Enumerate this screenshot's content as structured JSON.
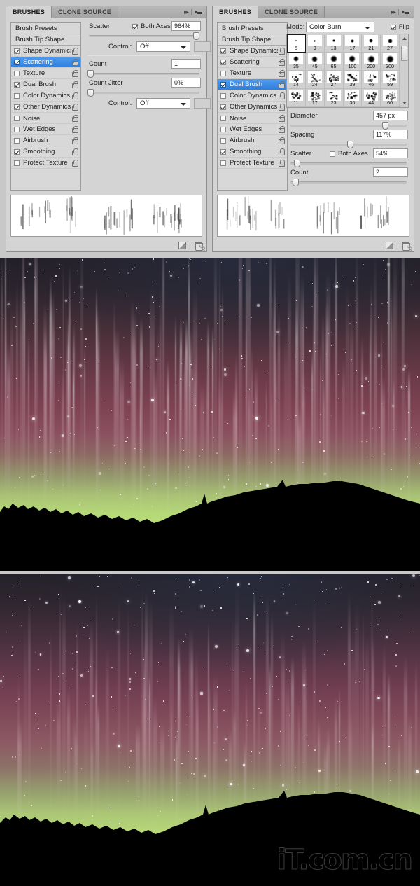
{
  "panels": {
    "left": {
      "tabs": [
        {
          "label": "BRUSHES",
          "active": true
        },
        {
          "label": "CLONE SOURCE",
          "active": false
        }
      ],
      "options": [
        {
          "label": "Brush Presets",
          "type": "header",
          "checkbox": null,
          "selected": false,
          "lock": false
        },
        {
          "label": "Brush Tip Shape",
          "type": "header",
          "checkbox": null,
          "selected": false,
          "lock": false
        },
        {
          "label": "Shape Dynamics",
          "type": "item",
          "checkbox": true,
          "selected": false,
          "lock": true
        },
        {
          "label": "Scattering",
          "type": "item",
          "checkbox": true,
          "selected": true,
          "lock": true
        },
        {
          "label": "Texture",
          "type": "item",
          "checkbox": false,
          "selected": false,
          "lock": true
        },
        {
          "label": "Dual Brush",
          "type": "item",
          "checkbox": true,
          "selected": false,
          "lock": true
        },
        {
          "label": "Color Dynamics",
          "type": "item",
          "checkbox": false,
          "selected": false,
          "lock": true
        },
        {
          "label": "Other Dynamics",
          "type": "item",
          "checkbox": true,
          "selected": false,
          "lock": true
        },
        {
          "label": "Noise",
          "type": "item-sep",
          "checkbox": false,
          "selected": false,
          "lock": true
        },
        {
          "label": "Wet Edges",
          "type": "item",
          "checkbox": false,
          "selected": false,
          "lock": true
        },
        {
          "label": "Airbrush",
          "type": "item",
          "checkbox": false,
          "selected": false,
          "lock": true
        },
        {
          "label": "Smoothing",
          "type": "item",
          "checkbox": true,
          "selected": false,
          "lock": true
        },
        {
          "label": "Protect Texture",
          "type": "item",
          "checkbox": false,
          "selected": false,
          "lock": true
        }
      ],
      "controls": {
        "scatter_label": "Scatter",
        "scatter_value": "964%",
        "both_axes_label": "Both Axes",
        "both_axes_checked": true,
        "control1_label": "Control:",
        "control1_value": "Off",
        "count_label": "Count",
        "count_value": "1",
        "count_jitter_label": "Count Jitter",
        "count_jitter_value": "0%",
        "control2_label": "Control:",
        "control2_value": "Off"
      }
    },
    "right": {
      "tabs": [
        {
          "label": "BRUSHES",
          "active": true
        },
        {
          "label": "CLONE SOURCE",
          "active": false
        }
      ],
      "options": [
        {
          "label": "Brush Presets",
          "type": "header",
          "checkbox": null,
          "selected": false,
          "lock": false
        },
        {
          "label": "Brush Tip Shape",
          "type": "header",
          "checkbox": null,
          "selected": false,
          "lock": false
        },
        {
          "label": "Shape Dynamics",
          "type": "item",
          "checkbox": true,
          "selected": false,
          "lock": true
        },
        {
          "label": "Scattering",
          "type": "item",
          "checkbox": true,
          "selected": false,
          "lock": true
        },
        {
          "label": "Texture",
          "type": "item",
          "checkbox": false,
          "selected": false,
          "lock": true
        },
        {
          "label": "Dual Brush",
          "type": "item",
          "checkbox": true,
          "selected": true,
          "lock": true
        },
        {
          "label": "Color Dynamics",
          "type": "item",
          "checkbox": false,
          "selected": false,
          "lock": true
        },
        {
          "label": "Other Dynamics",
          "type": "item",
          "checkbox": true,
          "selected": false,
          "lock": true
        },
        {
          "label": "Noise",
          "type": "item-sep",
          "checkbox": false,
          "selected": false,
          "lock": true
        },
        {
          "label": "Wet Edges",
          "type": "item",
          "checkbox": false,
          "selected": false,
          "lock": true
        },
        {
          "label": "Airbrush",
          "type": "item",
          "checkbox": false,
          "selected": false,
          "lock": true
        },
        {
          "label": "Smoothing",
          "type": "item",
          "checkbox": true,
          "selected": false,
          "lock": true
        },
        {
          "label": "Protect Texture",
          "type": "item",
          "checkbox": false,
          "selected": false,
          "lock": true
        }
      ],
      "controls": {
        "mode_label": "Mode:",
        "mode_value": "Color Burn",
        "flip_label": "Flip",
        "flip_checked": true,
        "diameter_label": "Diameter",
        "diameter_value": "457 px",
        "spacing_label": "Spacing",
        "spacing_value": "117%",
        "scatter_label": "Scatter",
        "scatter_value": "54%",
        "both_axes_label": "Both Axes",
        "both_axes_checked": false,
        "count_label": "Count",
        "count_value": "2"
      },
      "brush_tips": [
        {
          "size": "5",
          "dot": 2,
          "selected": true
        },
        {
          "size": "9",
          "dot": 3,
          "selected": false
        },
        {
          "size": "13",
          "dot": 4,
          "selected": false
        },
        {
          "size": "17",
          "dot": 5,
          "selected": false
        },
        {
          "size": "21",
          "dot": 6,
          "selected": false
        },
        {
          "size": "27",
          "dot": 7,
          "selected": false
        },
        {
          "size": "35",
          "dot": 8,
          "selected": false
        },
        {
          "size": "45",
          "dot": 9,
          "selected": false
        },
        {
          "size": "65",
          "dot": 10,
          "selected": false
        },
        {
          "size": "100",
          "dot": 10,
          "selected": false
        },
        {
          "size": "200",
          "dot": 11,
          "selected": false
        },
        {
          "size": "300",
          "dot": 11,
          "selected": false
        },
        {
          "size": "14",
          "dot": 0,
          "selected": false
        },
        {
          "size": "24",
          "dot": 0,
          "selected": false
        },
        {
          "size": "27",
          "dot": 0,
          "selected": false
        },
        {
          "size": "39",
          "dot": 0,
          "selected": false
        },
        {
          "size": "46",
          "dot": 0,
          "selected": false
        },
        {
          "size": "59",
          "dot": 0,
          "selected": false
        },
        {
          "size": "11",
          "dot": 0,
          "selected": false
        },
        {
          "size": "17",
          "dot": 0,
          "selected": false
        },
        {
          "size": "23",
          "dot": 0,
          "selected": false
        },
        {
          "size": "36",
          "dot": 0,
          "selected": false
        },
        {
          "size": "44",
          "dot": 0,
          "selected": false
        },
        {
          "size": "60",
          "dot": 0,
          "selected": false
        }
      ]
    }
  },
  "images": {
    "aurora_1": {
      "alt": "Aurora borealis over dark tree-line horizon, magenta to green sky",
      "watermark": ""
    },
    "aurora_2": {
      "alt": "Aurora borealis variation, softer magenta and green sky over hill silhouette",
      "watermark": "iT.com.cn"
    }
  },
  "colors": {
    "panel_bg": "#d4d4d4",
    "panel_border": "#8e8e8e",
    "selection_blue": "#2f7fdd",
    "sky_top": "#232029",
    "sky_magenta": "#7e4353",
    "sky_green": "#c4e57d",
    "horizon_black": "#000000"
  }
}
